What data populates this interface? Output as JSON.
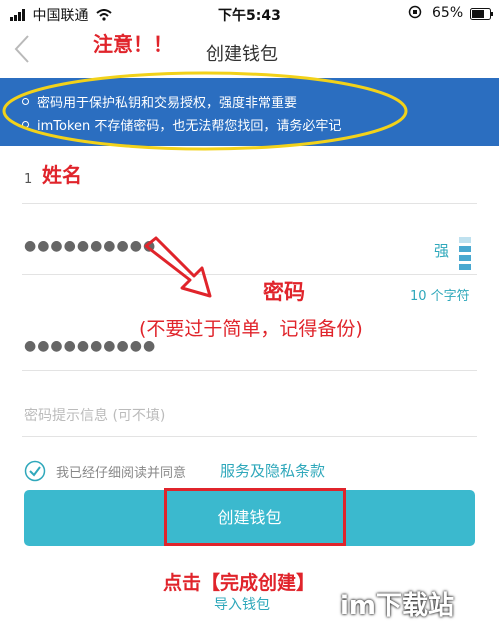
{
  "status_bar": {
    "carrier": "中国联通",
    "time": "下午5:43",
    "battery": "65%"
  },
  "nav": {
    "back_icon": "chevron-left-icon",
    "title": "创建钱包"
  },
  "banner": {
    "tips": [
      "密码用于保护私钥和交易授权，强度非常重要",
      "imToken 不存储密码，也无法帮您找回，请务必牢记"
    ]
  },
  "form": {
    "name_value": "1",
    "password_dots": "●●●●●●●●●●",
    "strength_label": "强",
    "char_count": "10 个字符",
    "confirm_dots": "●●●●●●●●●●",
    "hint_placeholder": "密码提示信息 (可不填)",
    "agree_text": "我已经仔细阅读并同意",
    "agree_link": "服务及隐私条款",
    "submit_label": "创建钱包",
    "import_label": "导入钱包"
  },
  "annotations": {
    "attention": "注意！！",
    "name": "姓名",
    "password": "密码",
    "password_note": "(不要过于简单，记得备份)",
    "click_note": "点击【完成创建】"
  },
  "watermark": "im下载站",
  "colors": {
    "banner": "#2b6ec0",
    "button": "#3bb9ce",
    "accent": "#2fa8bb",
    "annotation_red": "#e0242b",
    "highlight_yellow": "#f2d21a"
  }
}
